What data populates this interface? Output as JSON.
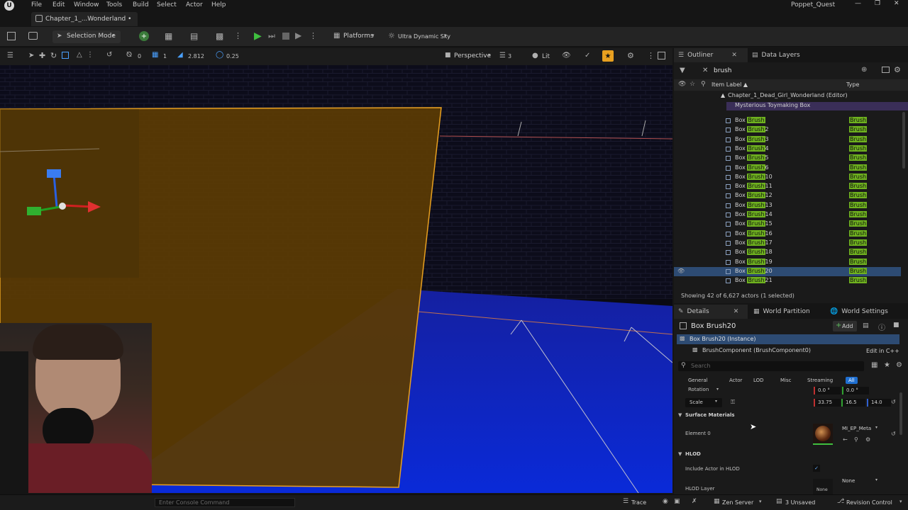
{
  "menu": [
    "File",
    "Edit",
    "Window",
    "Tools",
    "Build",
    "Select",
    "Actor",
    "Help"
  ],
  "project_name": "Poppet_Quest",
  "doc_tab": "Chapter_1_...Wonderland •",
  "toolbar": {
    "mode": "Selection Mode",
    "platforms": "Platforms",
    "sky": "Ultra Dynamic Sky"
  },
  "viewport_toolbar": {
    "rotate_snap": "0",
    "grid_snap": "1",
    "fov": "2.812",
    "speed": "0.25",
    "perspective": "Perspective",
    "camera_count": "3",
    "lit": "Lit"
  },
  "outliner": {
    "tab_outliner": "Outliner",
    "tab_layers": "Data Layers",
    "search": "brush",
    "col_label": "Item Label ▲",
    "col_type": "Type",
    "tree_root": "Chapter_1_Dead_Girl_Wonderland (Editor)",
    "tree_folder": "Mysterious Toymaking Box",
    "rows": [
      {
        "prefix": "Box ",
        "hl": "Brush",
        "suffix": "",
        "type": "Brush"
      },
      {
        "prefix": "Box ",
        "hl": "Brush",
        "suffix": "2",
        "type": "Brush"
      },
      {
        "prefix": "Box ",
        "hl": "Brush",
        "suffix": "3",
        "type": "Brush"
      },
      {
        "prefix": "Box ",
        "hl": "Brush",
        "suffix": "4",
        "type": "Brush"
      },
      {
        "prefix": "Box ",
        "hl": "Brush",
        "suffix": "5",
        "type": "Brush"
      },
      {
        "prefix": "Box ",
        "hl": "Brush",
        "suffix": "6",
        "type": "Brush"
      },
      {
        "prefix": "Box ",
        "hl": "Brush",
        "suffix": "10",
        "type": "Brush"
      },
      {
        "prefix": "Box ",
        "hl": "Brush",
        "suffix": "11",
        "type": "Brush"
      },
      {
        "prefix": "Box ",
        "hl": "Brush",
        "suffix": "12",
        "type": "Brush"
      },
      {
        "prefix": "Box ",
        "hl": "Brush",
        "suffix": "13",
        "type": "Brush"
      },
      {
        "prefix": "Box ",
        "hl": "Brush",
        "suffix": "14",
        "type": "Brush"
      },
      {
        "prefix": "Box ",
        "hl": "Brush",
        "suffix": "15",
        "type": "Brush"
      },
      {
        "prefix": "Box ",
        "hl": "Brush",
        "suffix": "16",
        "type": "Brush"
      },
      {
        "prefix": "Box ",
        "hl": "Brush",
        "suffix": "17",
        "type": "Brush"
      },
      {
        "prefix": "Box ",
        "hl": "Brush",
        "suffix": "18",
        "type": "Brush"
      },
      {
        "prefix": "Box ",
        "hl": "Brush",
        "suffix": "19",
        "type": "Brush"
      },
      {
        "prefix": "Box ",
        "hl": "Brush",
        "suffix": "20",
        "type": "Brush",
        "selected": true
      },
      {
        "prefix": "Box ",
        "hl": "Brush",
        "suffix": "21",
        "type": "Brush"
      }
    ],
    "status": "Showing 42 of 6,627 actors (1 selected)"
  },
  "details": {
    "tab_details": "Details",
    "tab_partition": "World Partition",
    "tab_settings": "World Settings",
    "title": "Box Brush20",
    "add": "Add",
    "instance": "Box Brush20 (Instance)",
    "component": "BrushComponent (BrushComponent0)",
    "edit_cpp": "Edit in C++",
    "search_placeholder": "Search",
    "categories": [
      "General",
      "Actor",
      "LOD",
      "Misc",
      "Streaming",
      "All"
    ],
    "rotation_label": "Rotation",
    "rotation_x": "0.0 °",
    "rotation_y": "0.0 °",
    "scale_label": "Scale",
    "scale_x": "33.75",
    "scale_y": "16.5",
    "scale_z": "14.0",
    "surface_materials": "Surface Materials",
    "element0": "Element 0",
    "material": "MI_EP_Meta",
    "hlod": "HLOD",
    "include_hlod": "Include Actor in HLOD",
    "hlod_layer": "HLOD Layer",
    "hlod_none": "None",
    "none_thumb": "None"
  },
  "status_bar": {
    "console_placeholder": "Enter Console Command",
    "trace": "Trace",
    "zen": "Zen Server",
    "unsaved": "3 Unsaved",
    "revision": "Revision Control"
  },
  "colors": {
    "accent_green": "#6fb21f",
    "selection_blue": "#2d4b73",
    "play_green": "#3fbf3f",
    "selection_orange": "#e8a020"
  }
}
